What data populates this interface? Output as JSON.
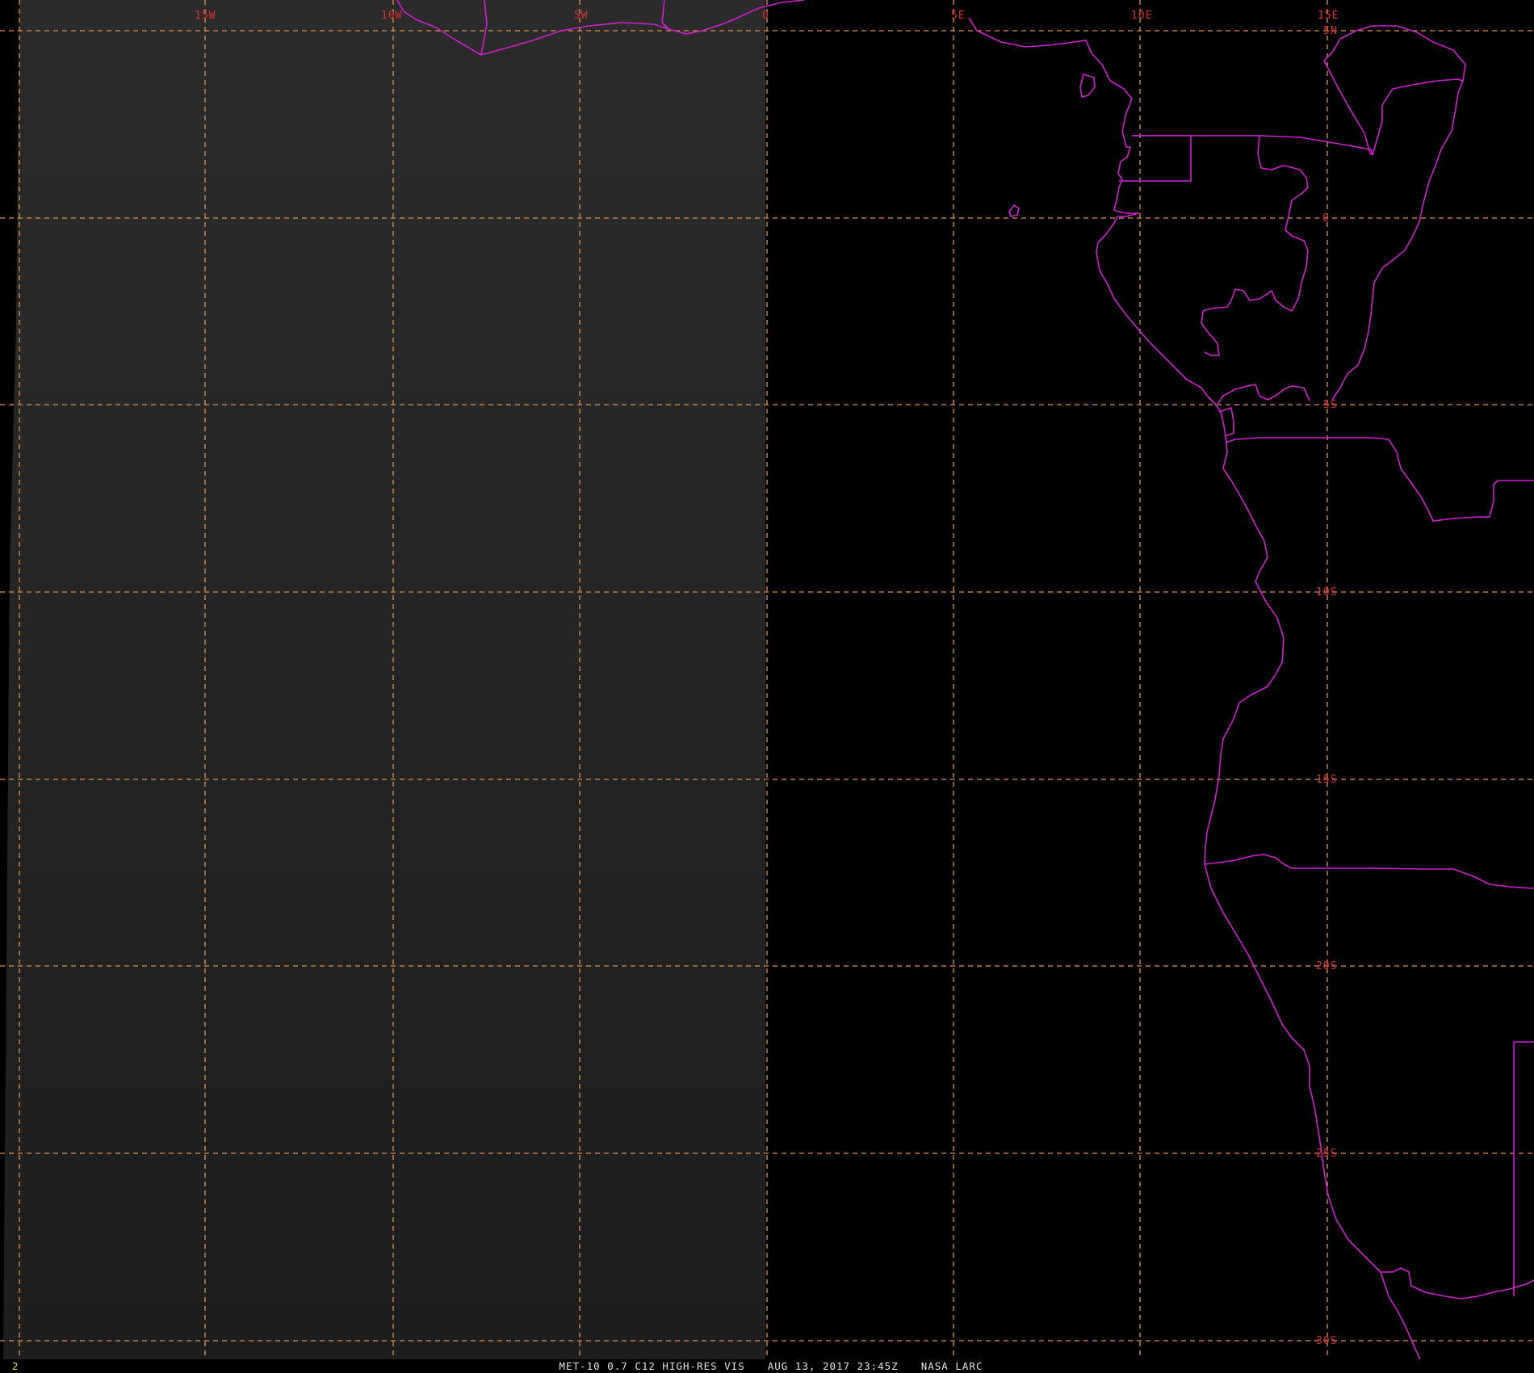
{
  "map": {
    "longitude_labels": [
      "15W",
      "10W",
      "5W",
      "0",
      "5E",
      "10E",
      "15E"
    ],
    "latitude_labels": [
      "5N",
      "0",
      "5S",
      "10S",
      "15S",
      "20S",
      "25S",
      "30S"
    ],
    "colors": {
      "background": "#000000",
      "night_shade": "#262626",
      "grid": "#e3944c",
      "coastline": "#d11fd0",
      "grid_label": "#d8332c"
    }
  },
  "status_bar": {
    "frame_number": "2",
    "product": "MET-10 0.7 C12 HIGH-RES VIS",
    "datetime": "AUG 13, 2017 23:45Z",
    "source": "NASA LARC"
  }
}
